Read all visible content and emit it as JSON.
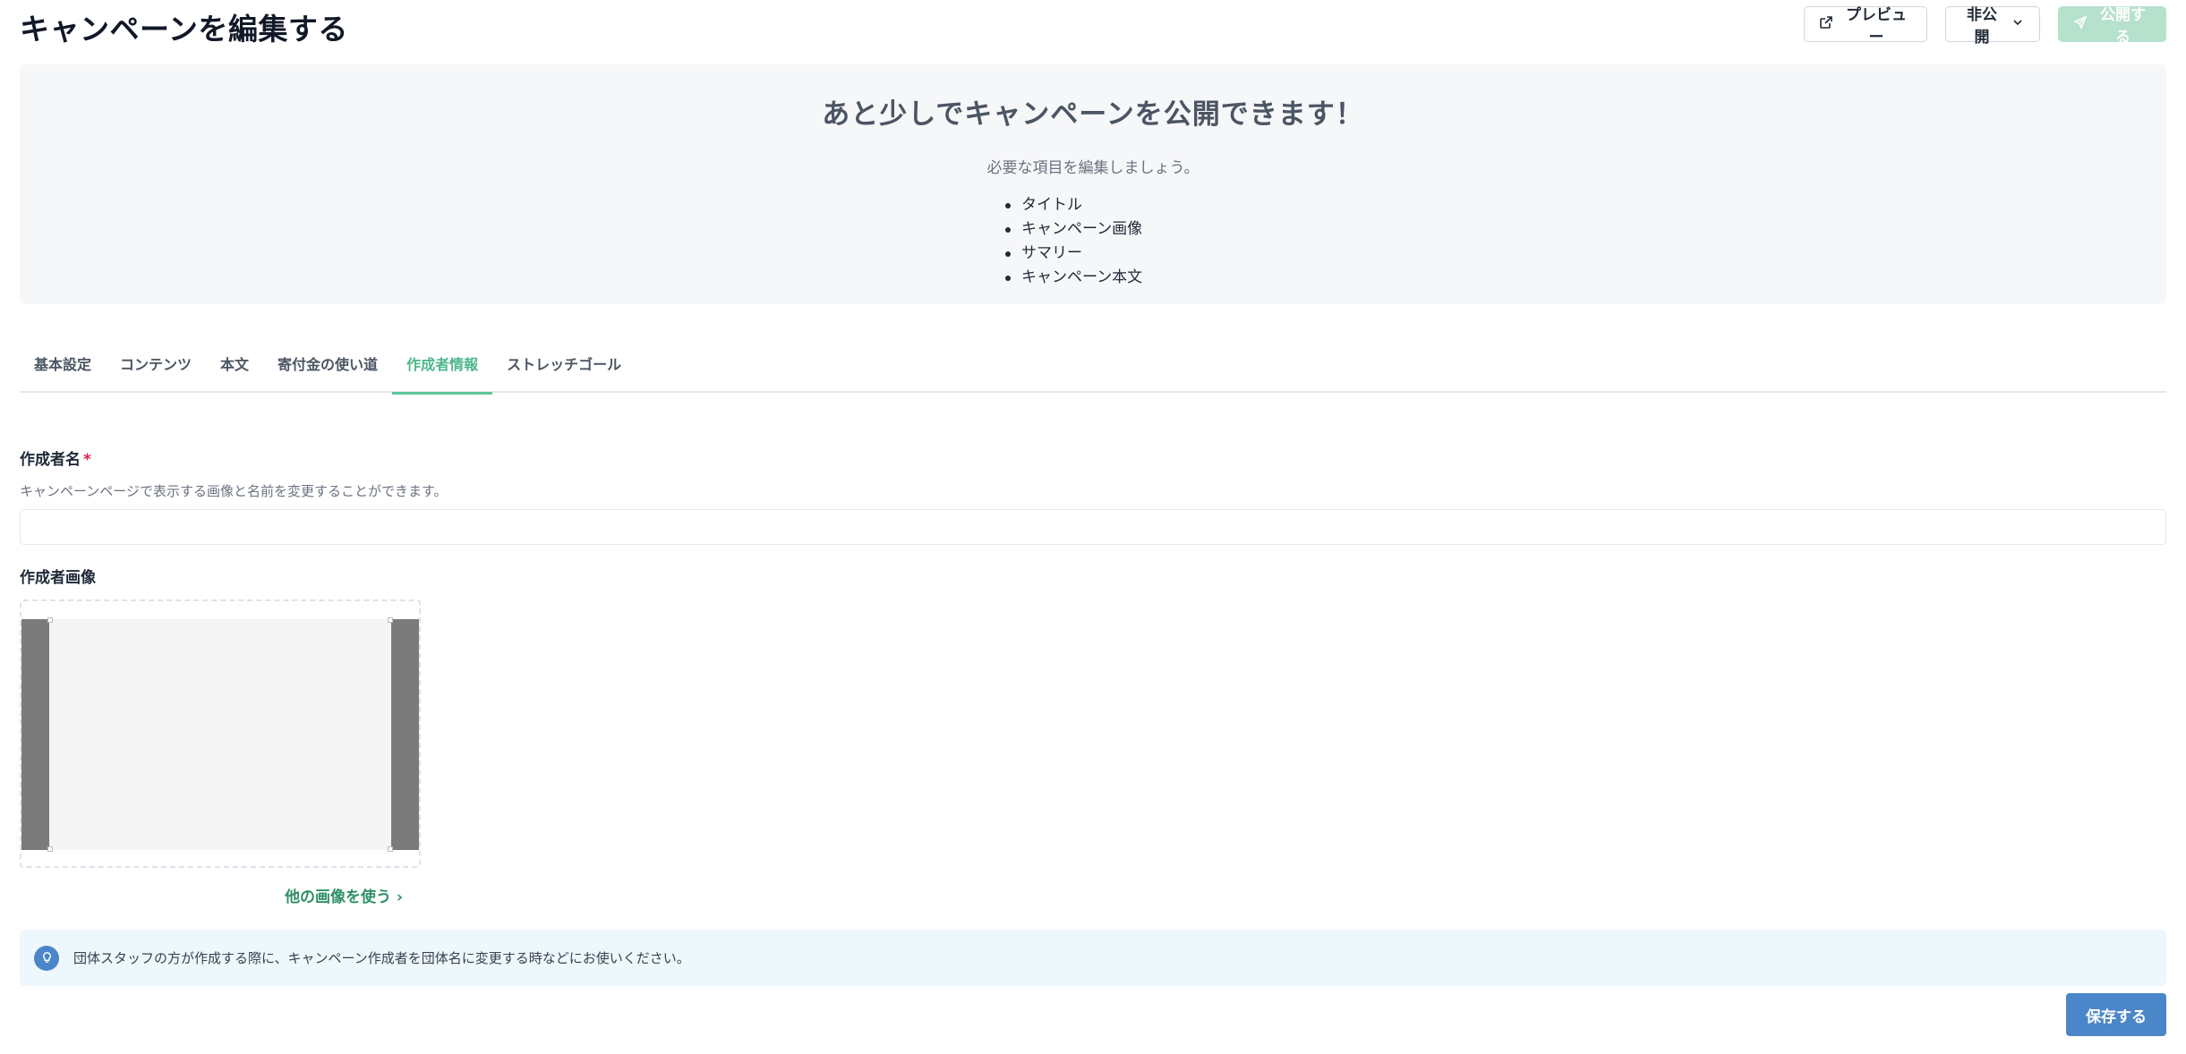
{
  "header": {
    "title": "キャンペーンを編集する",
    "preview_label": "プレビュー",
    "visibility_label": "非公開",
    "publish_label": "公開する"
  },
  "notice": {
    "title": "あと少しでキャンペーンを公開できます！",
    "subtitle": "必要な項目を編集しましょう。",
    "items": [
      "タイトル",
      "キャンペーン画像",
      "サマリー",
      "キャンペーン本文"
    ]
  },
  "tabs": [
    {
      "label": "基本設定",
      "active": false
    },
    {
      "label": "コンテンツ",
      "active": false
    },
    {
      "label": "本文",
      "active": false
    },
    {
      "label": "寄付金の使い道",
      "active": false
    },
    {
      "label": "作成者情報",
      "active": true
    },
    {
      "label": "ストレッチゴール",
      "active": false
    }
  ],
  "form": {
    "author_name_label": "作成者名",
    "required_mark": "*",
    "author_name_help": "キャンペーンページで表示する画像と名前を変更することができます。",
    "author_name_value": "",
    "author_image_label": "作成者画像",
    "change_image_label": "他の画像を使う ›"
  },
  "tip": {
    "text": "団体スタッフの方が作成する際に、キャンペーン作成者を団体名に変更する時などにお使いください。"
  },
  "save_label": "保存する",
  "colors": {
    "accent_green": "#4fb68a",
    "publish_disabled": "#b6e1cd",
    "save_blue": "#4b86c8",
    "tip_bg": "#eef7fc"
  }
}
